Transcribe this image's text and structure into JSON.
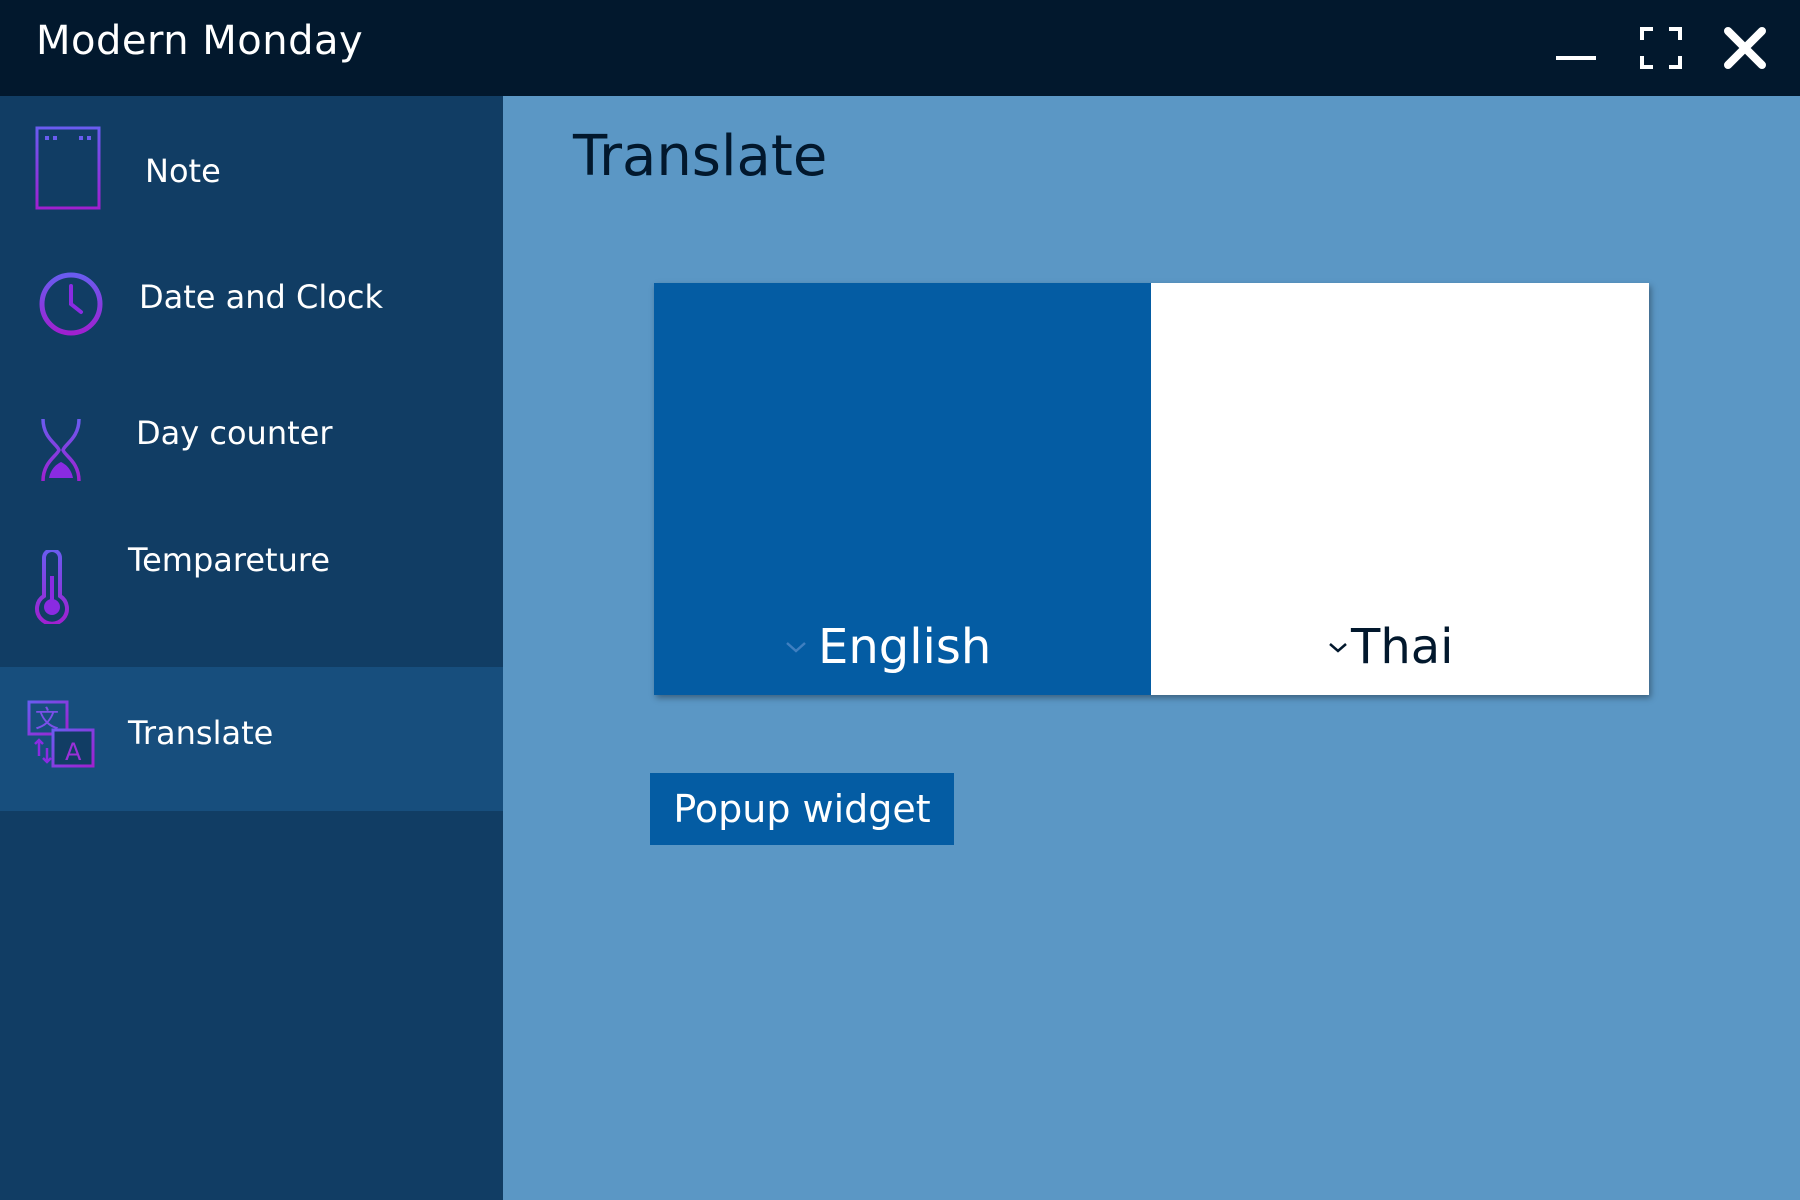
{
  "window": {
    "title": "Modern Monday",
    "controls": {
      "minimize_icon": "minimize-icon",
      "maximize_icon": "fullscreen-icon",
      "close_icon": "close-icon"
    }
  },
  "sidebar": {
    "items": [
      {
        "label": "Note",
        "icon": "note-icon",
        "active": false
      },
      {
        "label": "Date and Clock",
        "icon": "clock-icon",
        "active": false
      },
      {
        "label": "Day counter",
        "icon": "hourglass-icon",
        "active": false
      },
      {
        "label": "Tempareture",
        "icon": "thermometer-icon",
        "active": false
      },
      {
        "label": "Translate",
        "icon": "translate-icon",
        "active": true
      }
    ]
  },
  "main": {
    "title": "Translate",
    "source_language": "English",
    "target_language": "Thai",
    "popup_button_label": "Popup widget"
  },
  "colors": {
    "titlebar": "#02182d",
    "sidebar": "#113d64",
    "sidebar_active": "#174e7d",
    "main_bg": "#5b97c5",
    "accent": "#045ca3",
    "icon_purple": "#8a2be2"
  }
}
